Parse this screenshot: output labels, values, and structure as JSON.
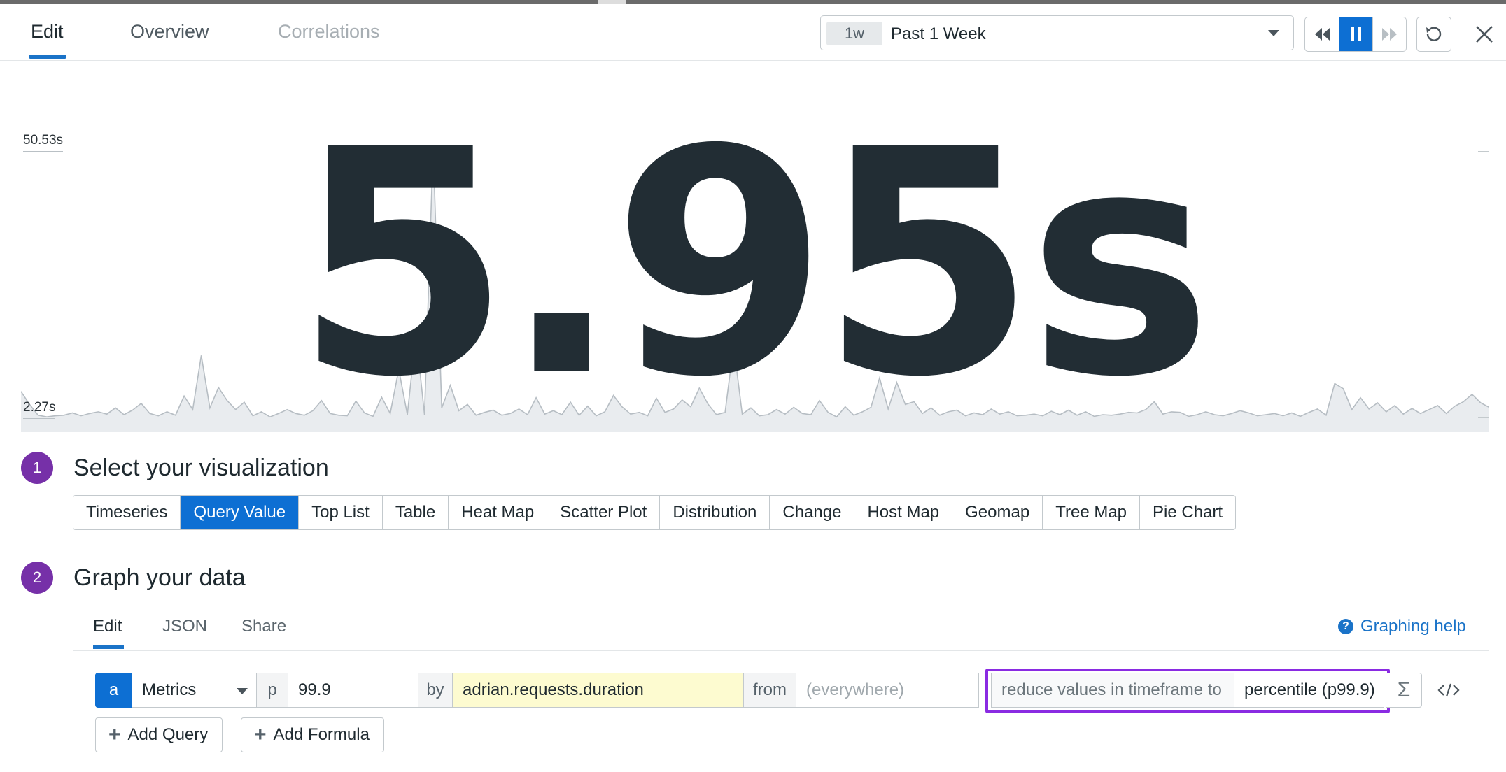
{
  "header": {
    "tabs": [
      {
        "label": "Edit",
        "state": "active"
      },
      {
        "label": "Overview",
        "state": "normal"
      },
      {
        "label": "Correlations",
        "state": "disabled"
      }
    ],
    "time_selector": {
      "badge": "1w",
      "label": "Past 1 Week"
    },
    "controls": {
      "rewind_icon": "rewind-icon",
      "pause_icon": "pause-icon",
      "forward_icon": "fast-forward-icon",
      "reset_icon": "reset-icon",
      "close_icon": "close-icon"
    }
  },
  "query_value": {
    "value": "5.95s",
    "y_max_label": "50.53s",
    "y_min_label": "2.27s",
    "sparkline": [
      7.2,
      4.9,
      3.0,
      2.7,
      2.9,
      3.0,
      3.4,
      2.9,
      3.3,
      3.6,
      3.2,
      4.3,
      3.1,
      3.9,
      5.1,
      3.3,
      2.9,
      3.6,
      3.0,
      6.4,
      4.0,
      13.6,
      4.3,
      7.9,
      5.6,
      4.0,
      5.3,
      2.9,
      3.6,
      2.7,
      3.3,
      4.0,
      3.3,
      3.0,
      3.8,
      5.6,
      3.3,
      3.0,
      2.9,
      5.5,
      3.4,
      2.8,
      6.2,
      3.3,
      11.1,
      3.1,
      17.4,
      3.1,
      50.5,
      4.3,
      8.3,
      3.8,
      4.9,
      3.0,
      3.5,
      3.9,
      3.0,
      3.3,
      4.1,
      3.1,
      6.1,
      3.2,
      3.8,
      3.1,
      5.3,
      3.0,
      4.6,
      2.9,
      3.6,
      6.5,
      4.5,
      3.2,
      3.5,
      2.9,
      6.0,
      3.5,
      4.1,
      5.7,
      4.5,
      7.8,
      5.0,
      3.1,
      3.5,
      15.4,
      3.2,
      4.3,
      2.9,
      3.1,
      4.0,
      3.2,
      4.4,
      3.3,
      3.1,
      5.6,
      3.5,
      2.7,
      4.5,
      3.0,
      3.6,
      4.4,
      9.6,
      4.1,
      8.8,
      4.9,
      5.4,
      3.3,
      4.3,
      3.0,
      3.6,
      3.9,
      2.9,
      3.4,
      3.1,
      4.1,
      3.2,
      3.6,
      2.9,
      3.0,
      3.2,
      2.9,
      3.7,
      3.1,
      3.9,
      3.0,
      3.6,
      2.8,
      3.1,
      3.0,
      3.2,
      3.5,
      3.4,
      4.0,
      5.4,
      3.2,
      3.6,
      3.5,
      2.8,
      3.1,
      3.6,
      3.1,
      2.9,
      3.3,
      3.8,
      3.4,
      2.9,
      3.1,
      3.3,
      2.9,
      3.4,
      2.8,
      3.5,
      4.1,
      3.0,
      8.6,
      7.7,
      4.0,
      6.1,
      4.1,
      5.2,
      3.6,
      4.7,
      3.2,
      4.2,
      3.3,
      4.0,
      4.7,
      3.3,
      4.6,
      5.4,
      6.7,
      5.2,
      4.4
    ]
  },
  "step1": {
    "number": "1",
    "title": "Select your visualization",
    "options": [
      {
        "label": "Timeseries",
        "active": false
      },
      {
        "label": "Query Value",
        "active": true
      },
      {
        "label": "Top List",
        "active": false
      },
      {
        "label": "Table",
        "active": false
      },
      {
        "label": "Heat Map",
        "active": false
      },
      {
        "label": "Scatter Plot",
        "active": false
      },
      {
        "label": "Distribution",
        "active": false
      },
      {
        "label": "Change",
        "active": false
      },
      {
        "label": "Host Map",
        "active": false
      },
      {
        "label": "Geomap",
        "active": false
      },
      {
        "label": "Tree Map",
        "active": false
      },
      {
        "label": "Pie Chart",
        "active": false
      }
    ]
  },
  "step2": {
    "number": "2",
    "title": "Graph your data",
    "tabs": [
      {
        "label": "Edit",
        "active": true
      },
      {
        "label": "JSON",
        "active": false
      },
      {
        "label": "Share",
        "active": false
      }
    ],
    "help_label": "Graphing help",
    "query": {
      "letter": "a",
      "source": "Metrics",
      "aggregator_prefix": "p",
      "aggregator_value": "99.9",
      "by_label": "by",
      "metric": "adrian.requests.duration",
      "from_label": "from",
      "from_placeholder": "(everywhere)",
      "reduce_label": "reduce values in timeframe to",
      "reduce_value": "percentile (p99.9)",
      "sigma_symbol": "Σ"
    },
    "add_query_label": "Add Query",
    "add_formula_label": "Add Formula"
  },
  "colors": {
    "accent": "#0d6fd3",
    "step": "#7630a8",
    "highlight": "#8a2be2",
    "metric_bg": "#fdfbd0",
    "big_value": "#222d34"
  }
}
